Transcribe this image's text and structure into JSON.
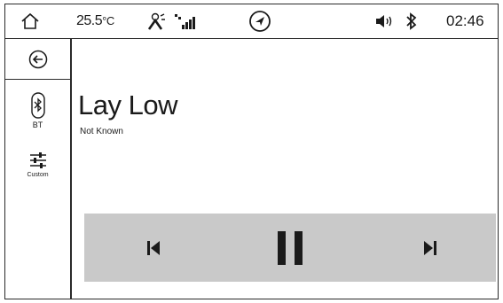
{
  "status_bar": {
    "temperature": "25.5",
    "temperature_unit": "°C",
    "time": "02:46",
    "icons": [
      "home-icon",
      "climate-fan-icon",
      "signal-strength-icon",
      "navigation-icon",
      "volume-icon",
      "bluetooth-icon"
    ]
  },
  "sidebar": {
    "back_icon": "back-arrow-icon",
    "items": [
      {
        "label": "BT",
        "icon": "bluetooth-icon"
      },
      {
        "label": "Custom",
        "icon": "equalizer-icon"
      }
    ]
  },
  "now_playing": {
    "title": "Lay Low",
    "artist": "Not Known"
  },
  "controls": {
    "icons": [
      "previous-track-icon",
      "pause-icon",
      "next-track-icon"
    ],
    "background": "#c9c9c9"
  }
}
